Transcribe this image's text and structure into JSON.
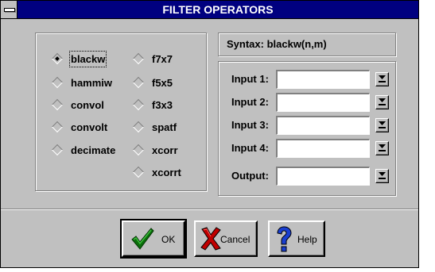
{
  "window": {
    "title": "FILTER OPERATORS"
  },
  "operators": {
    "left": [
      {
        "label": "blackw",
        "selected": true
      },
      {
        "label": "hammiw",
        "selected": false
      },
      {
        "label": "convol",
        "selected": false
      },
      {
        "label": "convolt",
        "selected": false
      },
      {
        "label": "decimate",
        "selected": false
      }
    ],
    "right": [
      {
        "label": "f7x7",
        "selected": false
      },
      {
        "label": "f5x5",
        "selected": false
      },
      {
        "label": "f3x3",
        "selected": false
      },
      {
        "label": "spatf",
        "selected": false
      },
      {
        "label": "xcorr",
        "selected": false
      },
      {
        "label": "xcorrt",
        "selected": false
      }
    ]
  },
  "syntax": {
    "text": "Syntax:  blackw(n,m)"
  },
  "io": {
    "input1": {
      "label": "Input 1:",
      "value": ""
    },
    "input2": {
      "label": "Input 2:",
      "value": ""
    },
    "input3": {
      "label": "Input 3:",
      "value": ""
    },
    "input4": {
      "label": "Input 4:",
      "value": ""
    },
    "output": {
      "label": "Output:",
      "value": ""
    }
  },
  "buttons": {
    "ok": "OK",
    "cancel": "Cancel",
    "help": "Help"
  },
  "colors": {
    "title_bar": "#000080",
    "face": "#c0c0c0",
    "check": "#0a6e0a",
    "cancel_x": "#c00000",
    "help_q": "#0000c0"
  },
  "icons": {
    "sys_menu": "minus-bar-icon",
    "dropdown": "down-arrow-bar-icon",
    "ok": "checkmark-icon",
    "cancel": "red-x-icon",
    "help": "question-mark-icon"
  }
}
